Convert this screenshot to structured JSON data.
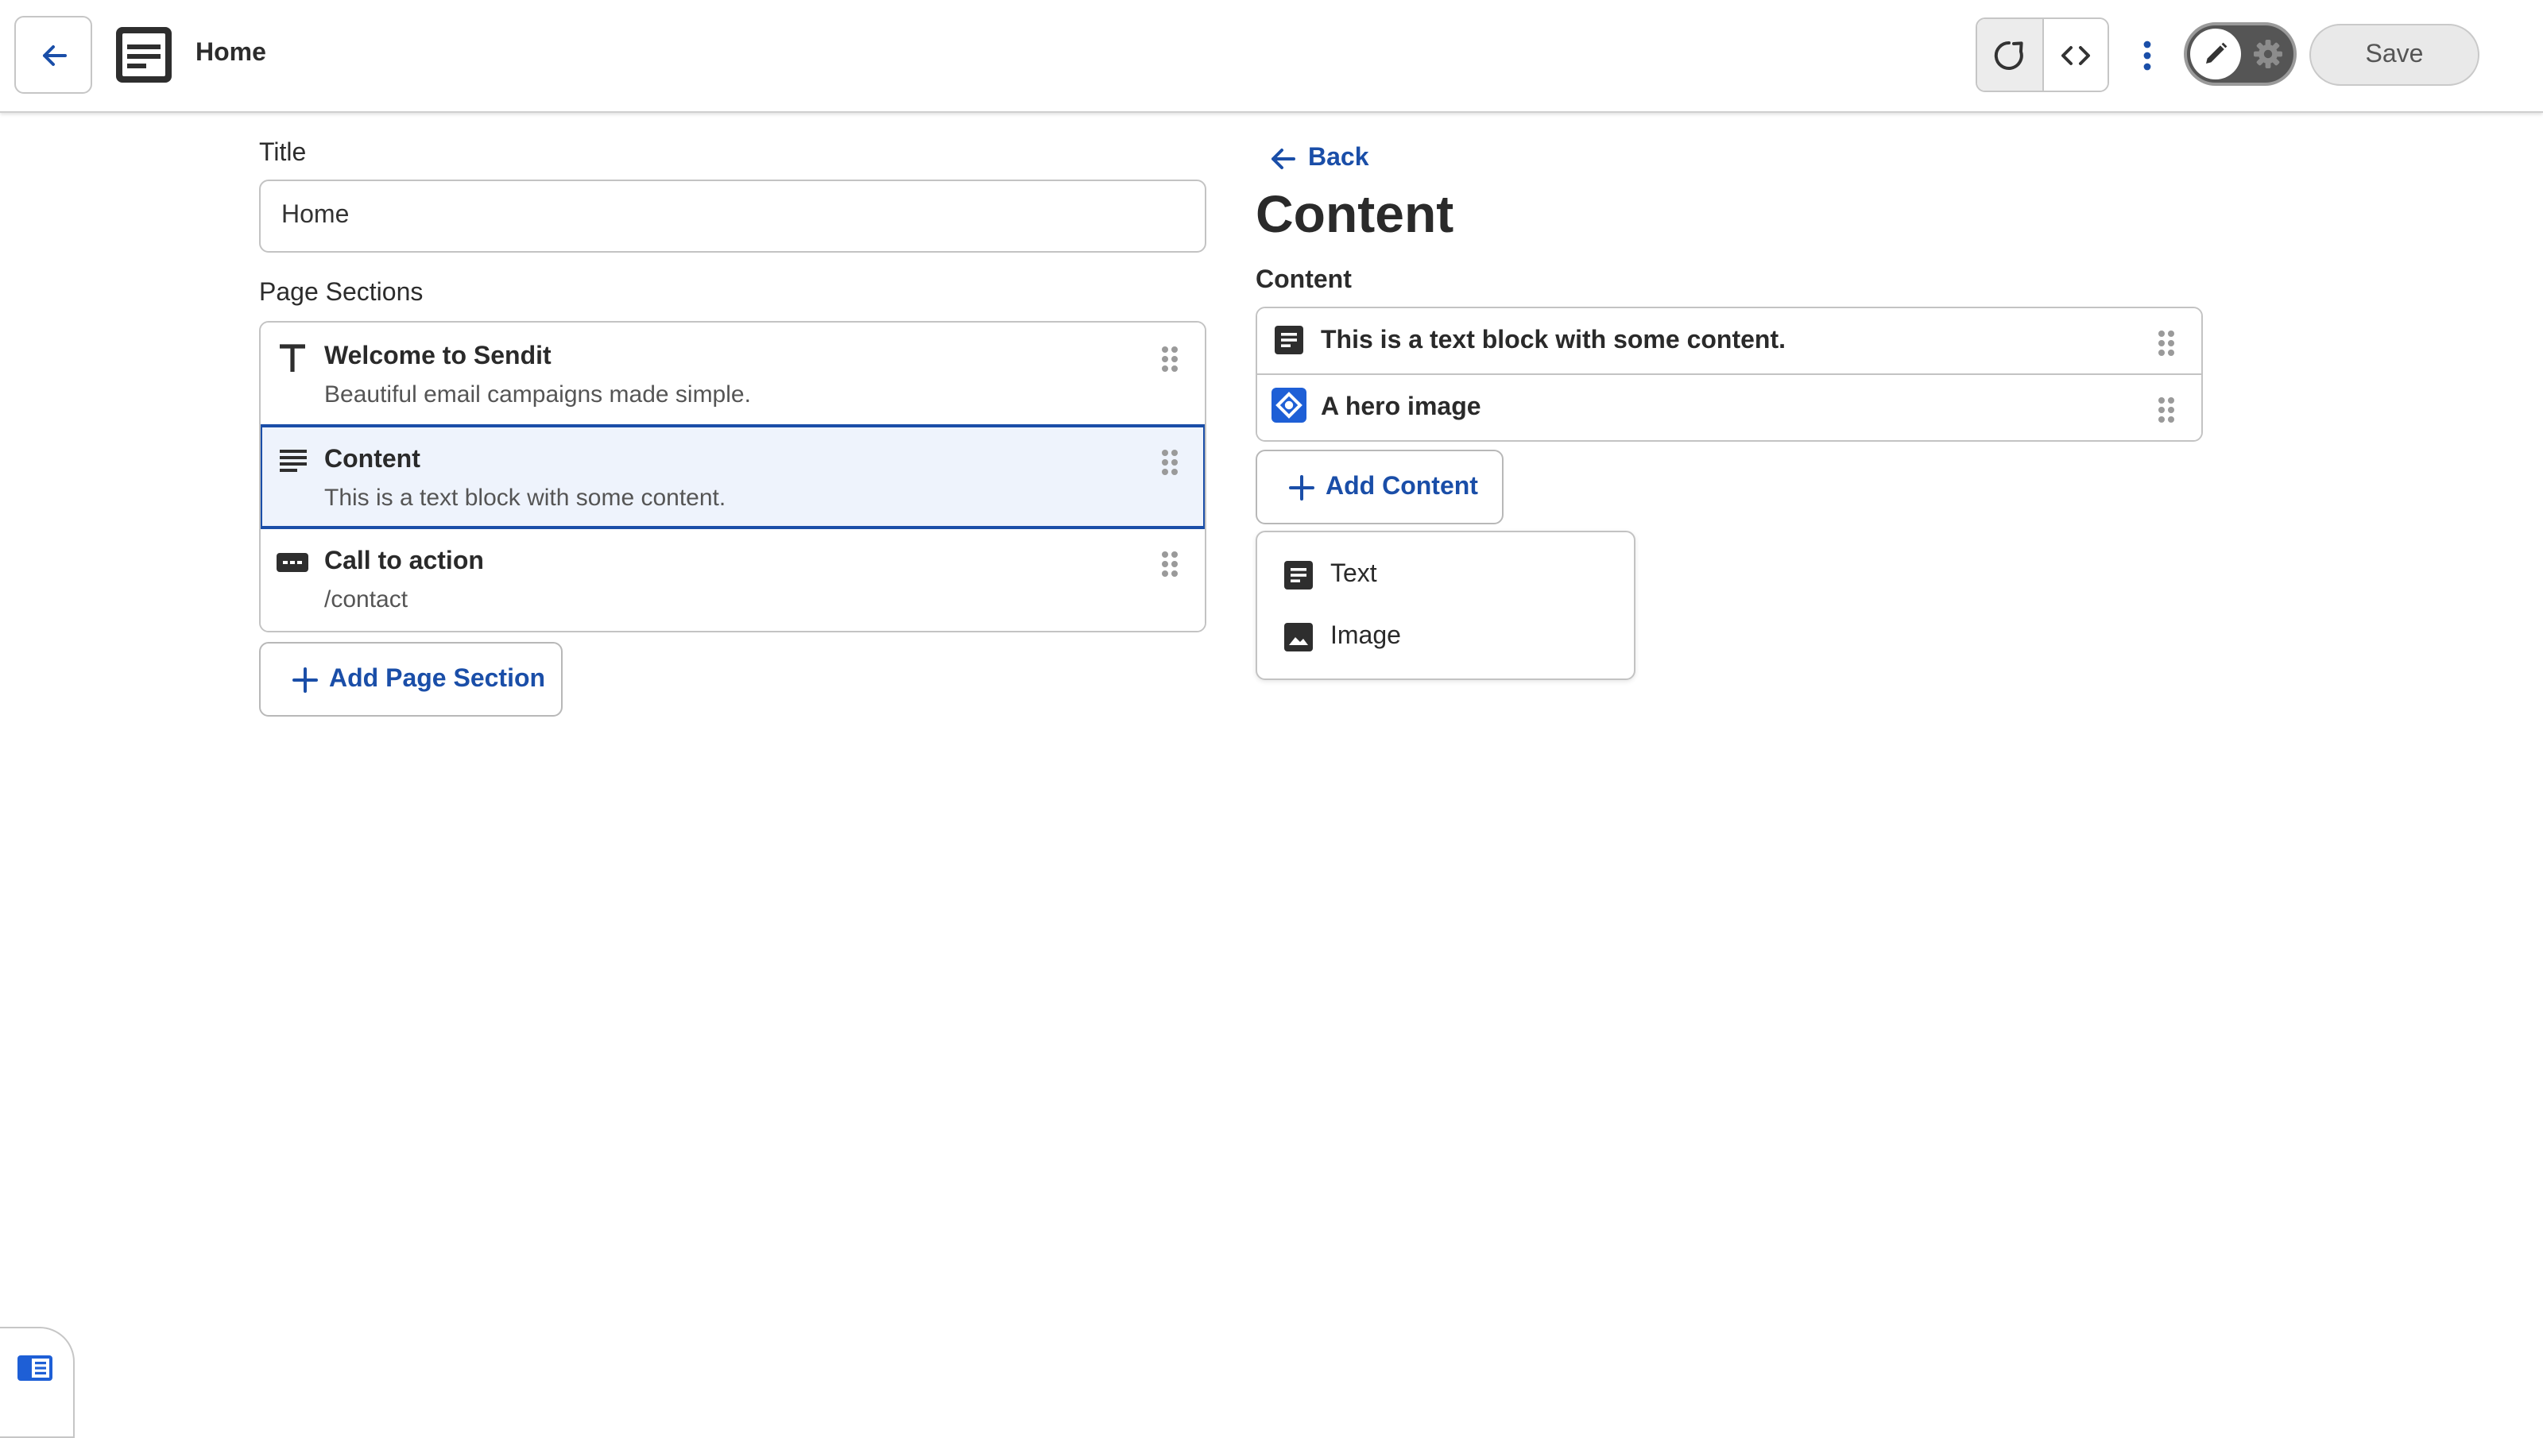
{
  "header": {
    "page_name": "Home",
    "save_label": "Save",
    "icons": [
      "arrow-left-icon",
      "document-icon",
      "refresh-icon",
      "code-icon",
      "more-vertical-icon",
      "pencil-icon",
      "gear-icon"
    ]
  },
  "editor": {
    "title_label": "Title",
    "title_value": "Home",
    "sections_label": "Page Sections",
    "sections": [
      {
        "title": "Welcome to Sendit",
        "subtitle": "Beautiful email campaigns made simple.",
        "icon": "heading-icon",
        "selected": false
      },
      {
        "title": "Content",
        "subtitle": "This is a text block with some content.",
        "icon": "text-lines-icon",
        "selected": true
      },
      {
        "title": "Call to action",
        "subtitle": "/contact",
        "icon": "button-icon",
        "selected": false
      }
    ],
    "add_section_label": "Add Page Section"
  },
  "detail": {
    "back_label": "Back",
    "heading": "Content",
    "content_label": "Content",
    "items": [
      {
        "text": "This is a text block with some content.",
        "icon": "text-block-icon"
      },
      {
        "text": "A hero image",
        "icon": "hero-image-icon"
      }
    ],
    "add_content_label": "Add Content",
    "menu": [
      {
        "label": "Text",
        "icon": "text-block-icon"
      },
      {
        "label": "Image",
        "icon": "image-icon"
      }
    ]
  },
  "colors": {
    "accent": "#1a4ea8",
    "selected_bg": "#eef3fc",
    "border": "#c3c3c3",
    "toggle_bg": "#555555"
  }
}
